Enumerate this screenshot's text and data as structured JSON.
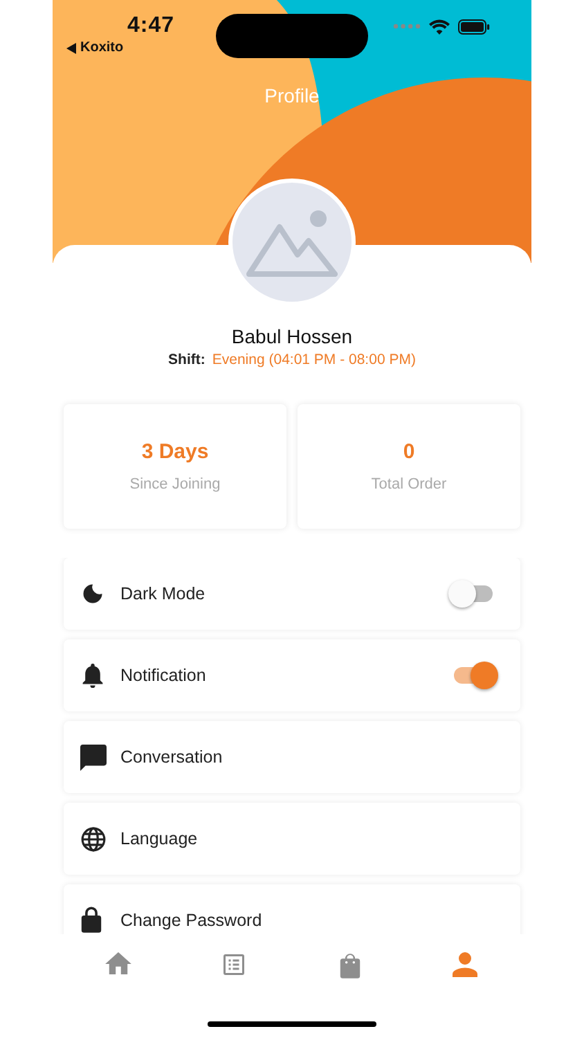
{
  "status_bar": {
    "time": "4:47",
    "back_label": "Koxito"
  },
  "header": {
    "title": "Profile"
  },
  "profile": {
    "name": "Babul Hossen",
    "shift_label": "Shift:",
    "shift_value": "Evening (04:01 PM - 08:00 PM)"
  },
  "stats": [
    {
      "value": "3 Days",
      "label": "Since Joining"
    },
    {
      "value": "0",
      "label": "Total Order"
    }
  ],
  "menu": [
    {
      "kind": "toggle",
      "label": "Dark Mode",
      "on": false
    },
    {
      "kind": "toggle",
      "label": "Notification",
      "on": true
    },
    {
      "kind": "link",
      "label": "Conversation"
    },
    {
      "kind": "link",
      "label": "Language"
    },
    {
      "kind": "link",
      "label": "Change Password"
    }
  ],
  "tabs": [
    {
      "selected": false
    },
    {
      "selected": false
    },
    {
      "selected": false
    },
    {
      "selected": true
    }
  ]
}
